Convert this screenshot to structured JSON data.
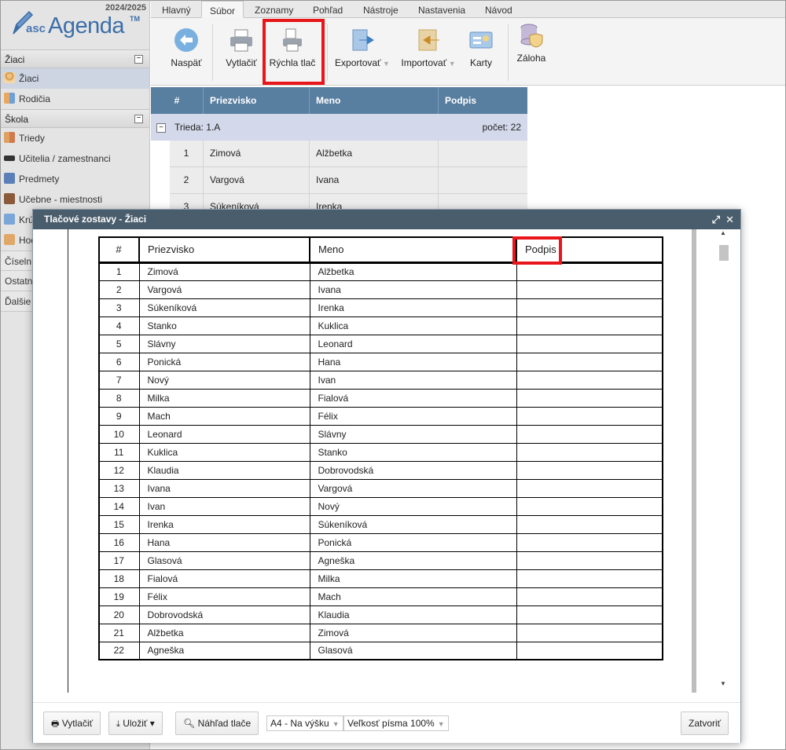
{
  "app": {
    "year": "2024/2025",
    "logo_prefix": "asc",
    "logo_name": "Agenda",
    "logo_tm": "TM"
  },
  "tabs": [
    "Hlavný",
    "Súbor",
    "Zoznamy",
    "Pohľad",
    "Nástroje",
    "Nastavenia",
    "Návod"
  ],
  "active_tab": "Súbor",
  "ribbon": {
    "back": "Naspäť",
    "print": "Vytlačiť",
    "quick_print": "Rýchla tlač",
    "export": "Exportovať",
    "import": "Importovať",
    "cards": "Karty",
    "backup": "Záloha"
  },
  "sidebar": {
    "sec_students": "Žiaci",
    "item_students": "Žiaci",
    "item_parents": "Rodičia",
    "sec_school": "Škola",
    "item_classes": "Triedy",
    "item_teachers": "Učitelia / zamestnanci",
    "item_subjects": "Predmety",
    "item_rooms": "Učebne - miestnosti",
    "item_k": "Krú",
    "item_h": "Hod",
    "plain1": "Číseln",
    "plain2": "Ostatn",
    "plain3": "Ďalšie"
  },
  "grid": {
    "headers": [
      "#",
      "Priezvisko",
      "Meno",
      "Podpis"
    ],
    "group_label": "Trieda: 1.A",
    "group_count": "počet: 22",
    "rows": [
      {
        "n": "1",
        "last": "Zimová",
        "first": "Alžbetka"
      },
      {
        "n": "2",
        "last": "Vargová",
        "first": "Ivana"
      },
      {
        "n": "3",
        "last": "Súkeníková",
        "first": "Irenka"
      }
    ]
  },
  "modal": {
    "title": "Tlačové zostavy - Žiaci",
    "table_headers": [
      "#",
      "Priezvisko",
      "Meno",
      "Podpis"
    ],
    "rows": [
      [
        "1",
        "Zimová",
        "Alžbetka"
      ],
      [
        "2",
        "Vargová",
        "Ivana"
      ],
      [
        "3",
        "Súkeníková",
        "Irenka"
      ],
      [
        "4",
        "Stanko",
        "Kuklica"
      ],
      [
        "5",
        "Slávny",
        "Leonard"
      ],
      [
        "6",
        "Ponická",
        "Hana"
      ],
      [
        "7",
        "Nový",
        "Ivan"
      ],
      [
        "8",
        "Milka",
        "Fialová"
      ],
      [
        "9",
        "Mach",
        "Félix"
      ],
      [
        "10",
        "Leonard",
        "Slávny"
      ],
      [
        "11",
        "Kuklica",
        "Stanko"
      ],
      [
        "12",
        "Klaudia",
        "Dobrovodská"
      ],
      [
        "13",
        "Ivana",
        "Vargová"
      ],
      [
        "14",
        "Ivan",
        "Nový"
      ],
      [
        "15",
        "Irenka",
        "Súkeníková"
      ],
      [
        "16",
        "Hana",
        "Ponická"
      ],
      [
        "17",
        "Glasová",
        "Agneška"
      ],
      [
        "18",
        "Fialová",
        "Milka"
      ],
      [
        "19",
        "Félix",
        "Mach"
      ],
      [
        "20",
        "Dobrovodská",
        "Klaudia"
      ],
      [
        "21",
        "Alžbetka",
        "Zimová"
      ],
      [
        "22",
        "Agneška",
        "Glasová"
      ]
    ],
    "footer": {
      "print": "Vytlačiť",
      "save": "Uložiť ▾",
      "preview": "Náhľad tlače",
      "paper": "A4 - Na výšku",
      "font_size": "Veľkosť písma 100%",
      "close": "Zatvoriť"
    }
  },
  "colors": {
    "highlight": "#e8151b",
    "grid_header": "#587ea0",
    "modal_title": "#4a5d6c"
  }
}
